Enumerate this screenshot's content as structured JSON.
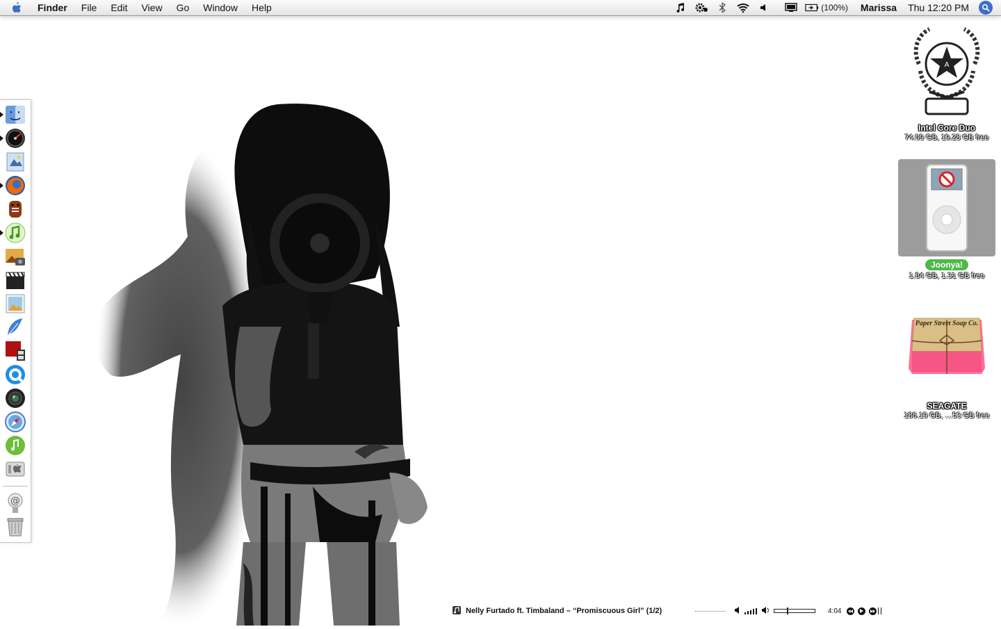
{
  "menubar": {
    "app_name": "Finder",
    "menus": [
      "File",
      "Edit",
      "View",
      "Go",
      "Window",
      "Help"
    ],
    "battery_text": "(100%)",
    "user": "Marissa",
    "clock": "Thu 12:20 PM",
    "extras": [
      "itunes-note-icon",
      "gear-icon",
      "bluetooth-icon",
      "wifi-icon",
      "volume-icon",
      "display-icon",
      "battery-icon",
      "spotlight-icon"
    ]
  },
  "dock": {
    "items": [
      {
        "name": "finder",
        "running": true
      },
      {
        "name": "dashboard",
        "running": true
      },
      {
        "name": "mail",
        "running": false
      },
      {
        "name": "firefox",
        "running": true
      },
      {
        "name": "domo",
        "running": false
      },
      {
        "name": "itunes",
        "running": true
      },
      {
        "name": "iphoto",
        "running": false
      },
      {
        "name": "final-cut",
        "running": false
      },
      {
        "name": "preview",
        "running": false
      },
      {
        "name": "feather-app",
        "running": false
      },
      {
        "name": "photo-booth",
        "running": false
      },
      {
        "name": "quicktime",
        "running": false
      },
      {
        "name": "webcam-app",
        "running": false
      },
      {
        "name": "safari",
        "running": false
      },
      {
        "name": "music-app",
        "running": false
      },
      {
        "name": "system-preferences",
        "running": false
      },
      {
        "name": "mail-stack",
        "running": false
      },
      {
        "name": "trash",
        "running": false
      }
    ]
  },
  "desktop": {
    "drives": [
      {
        "label": "Intel Core Duo",
        "info": "74.09 GB, 19.28 GB free",
        "icon": "obey-logo-icon",
        "selected": false
      },
      {
        "label": "Joonya!",
        "info": "1.84 GB, 1.31 GB free",
        "icon": "ipod-nano-icon",
        "selected": true
      },
      {
        "label": "SEAGATE",
        "info": "186.19 GB, …53 GB free",
        "icon": "soap-bar-icon",
        "selected": false
      }
    ],
    "soap_text": "Paper Street Soap Co."
  },
  "now_playing": {
    "track": "Nelly Furtado ft. Timbaland – “Promiscuous Girl” (1/2)",
    "time": "4:04",
    "progress": 0.33
  },
  "colors": {
    "selection_green": "#4fb84a",
    "selection_gray": "#9c9c9c",
    "spotlight_blue": "#3d6fc8"
  }
}
